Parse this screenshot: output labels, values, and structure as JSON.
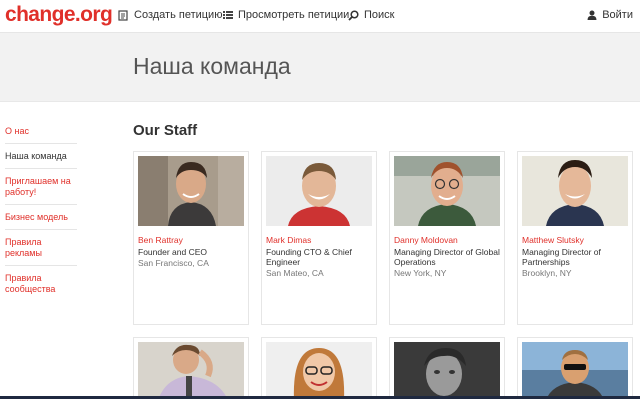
{
  "header": {
    "logo": "change.org",
    "nav": {
      "create": "Создать петицию",
      "browse": "Просмотреть петиции",
      "search": "Поиск",
      "login": "Войти"
    }
  },
  "banner": {
    "title": "Наша команда"
  },
  "sidebar": {
    "items": [
      {
        "label": "О нас"
      },
      {
        "label": "Наша команда"
      },
      {
        "label": "Приглашаем на работу!"
      },
      {
        "label": "Бизнес модель"
      },
      {
        "label": "Правила рекламы"
      },
      {
        "label": "Правила сообщества"
      }
    ]
  },
  "main": {
    "section_title": "Our Staff",
    "staff": [
      {
        "name": "Ben Rattray",
        "role": "Founder and CEO",
        "location": "San Francisco, CA"
      },
      {
        "name": "Mark Dimas",
        "role": "Founding CTO & Chief Engineer",
        "location": "San Mateo, CA"
      },
      {
        "name": "Danny Moldovan",
        "role": "Managing Director of Global Operations",
        "location": "New York, NY"
      },
      {
        "name": "Matthew Slutsky",
        "role": "Managing Director of Partnerships",
        "location": "Brooklyn, NY"
      }
    ]
  },
  "colors": {
    "brand": "#e0302a",
    "banner": "#f2f2f2"
  }
}
